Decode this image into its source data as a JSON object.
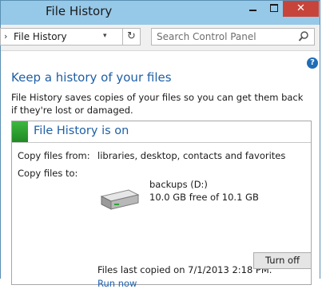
{
  "window": {
    "title": "File History",
    "close_glyph": "✕"
  },
  "address_bar": {
    "separator": "›",
    "crumb": "File History",
    "dropdown_glyph": "▾",
    "refresh_glyph": "↻"
  },
  "search": {
    "placeholder": "Search Control Panel"
  },
  "help": {
    "glyph": "?"
  },
  "main": {
    "heading": "Keep a history of your files",
    "description": "File History saves copies of your files so you can get them back if they're lost or damaged."
  },
  "status_panel": {
    "title": "File History is on",
    "accent_color": "#2ea534",
    "copy_from_label": "Copy files from:",
    "copy_from_value": "libraries, desktop, contacts and favorites",
    "copy_to_label": "Copy files to:",
    "drive_name": "backups (D:)",
    "drive_space": "10.0 GB free of 10.1 GB",
    "last_copied": "Files last copied on 7/1/2013 2:18 PM.",
    "run_now": "Run now"
  },
  "actions": {
    "turn_off": "Turn off"
  },
  "icons": [
    "minimize-icon",
    "maximize-icon",
    "close-icon",
    "chevron-right-icon",
    "refresh-icon",
    "search-icon",
    "help-icon",
    "hard-drive-icon"
  ]
}
